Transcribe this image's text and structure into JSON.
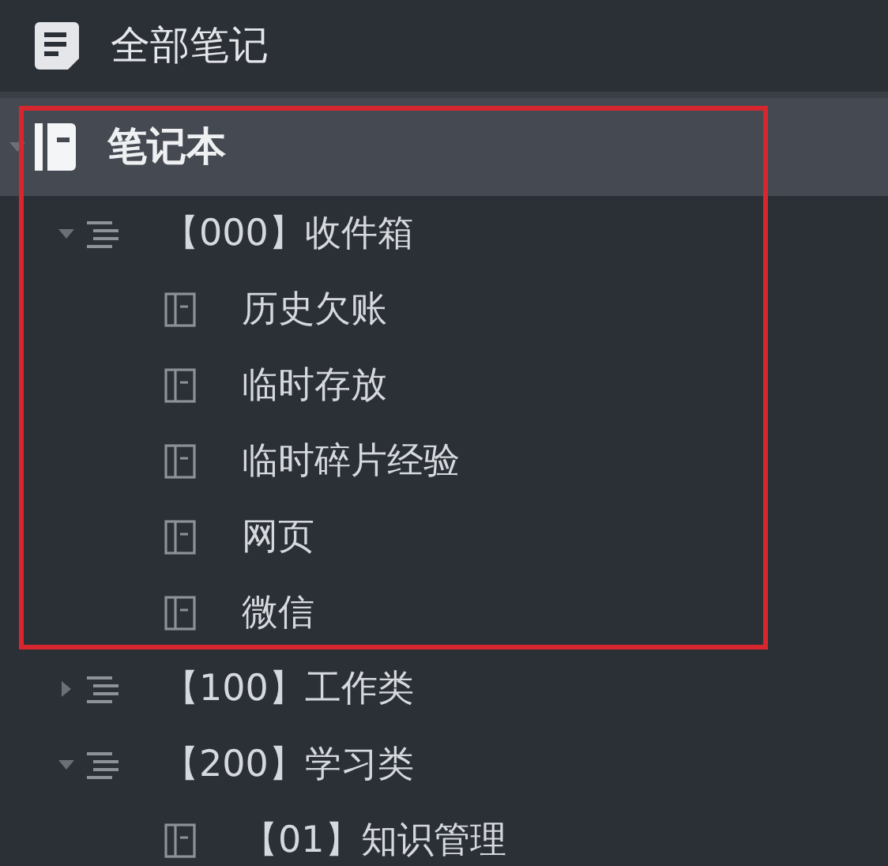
{
  "sidebar": {
    "all_notes": {
      "label": "全部笔记"
    },
    "notebooks": {
      "label": "笔记本",
      "selected": true,
      "expanded": true,
      "children": [
        {
          "label": "【000】收件箱",
          "kind": "stack",
          "expanded": true,
          "children": [
            {
              "label": "历史欠账",
              "kind": "notebook"
            },
            {
              "label": "临时存放",
              "kind": "notebook"
            },
            {
              "label": "临时碎片经验",
              "kind": "notebook"
            },
            {
              "label": "网页",
              "kind": "notebook"
            },
            {
              "label": "微信",
              "kind": "notebook"
            }
          ]
        },
        {
          "label": "【100】工作类",
          "kind": "stack",
          "expanded": false
        },
        {
          "label": "【200】学习类",
          "kind": "stack",
          "expanded": true,
          "children": [
            {
              "label": "【01】知识管理",
              "kind": "notebook"
            }
          ]
        }
      ]
    }
  },
  "annotation_frame": true
}
